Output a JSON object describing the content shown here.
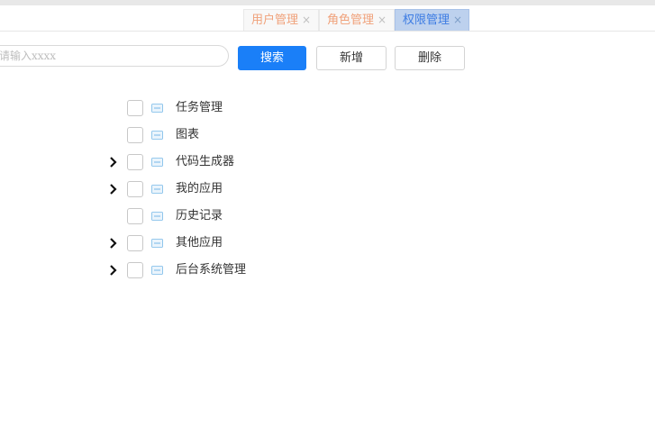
{
  "tabs": [
    {
      "label": "用户管理",
      "close": "×",
      "active": false
    },
    {
      "label": "角色管理",
      "close": "×",
      "active": false
    },
    {
      "label": "权限管理",
      "close": "×",
      "active": true
    }
  ],
  "toolbar": {
    "search_placeholder": "请输入xxxx",
    "search_value": "",
    "search_label": "搜索",
    "add_label": "新增",
    "delete_label": "删除"
  },
  "tree": {
    "nodes": [
      {
        "label": "任务管理",
        "expandable": false,
        "checked": false
      },
      {
        "label": "图表",
        "expandable": false,
        "checked": false
      },
      {
        "label": "代码生成器",
        "expandable": true,
        "checked": false
      },
      {
        "label": "我的应用",
        "expandable": true,
        "checked": false
      },
      {
        "label": "历史记录",
        "expandable": false,
        "checked": false
      },
      {
        "label": "其他应用",
        "expandable": true,
        "checked": false
      },
      {
        "label": "后台系统管理",
        "expandable": true,
        "checked": false
      }
    ]
  },
  "colors": {
    "primary": "#1a7ff8",
    "tab_active_bg": "#bdd1ee",
    "tab_text": "#f0a17a",
    "menu_icon": "#78b9e8"
  }
}
